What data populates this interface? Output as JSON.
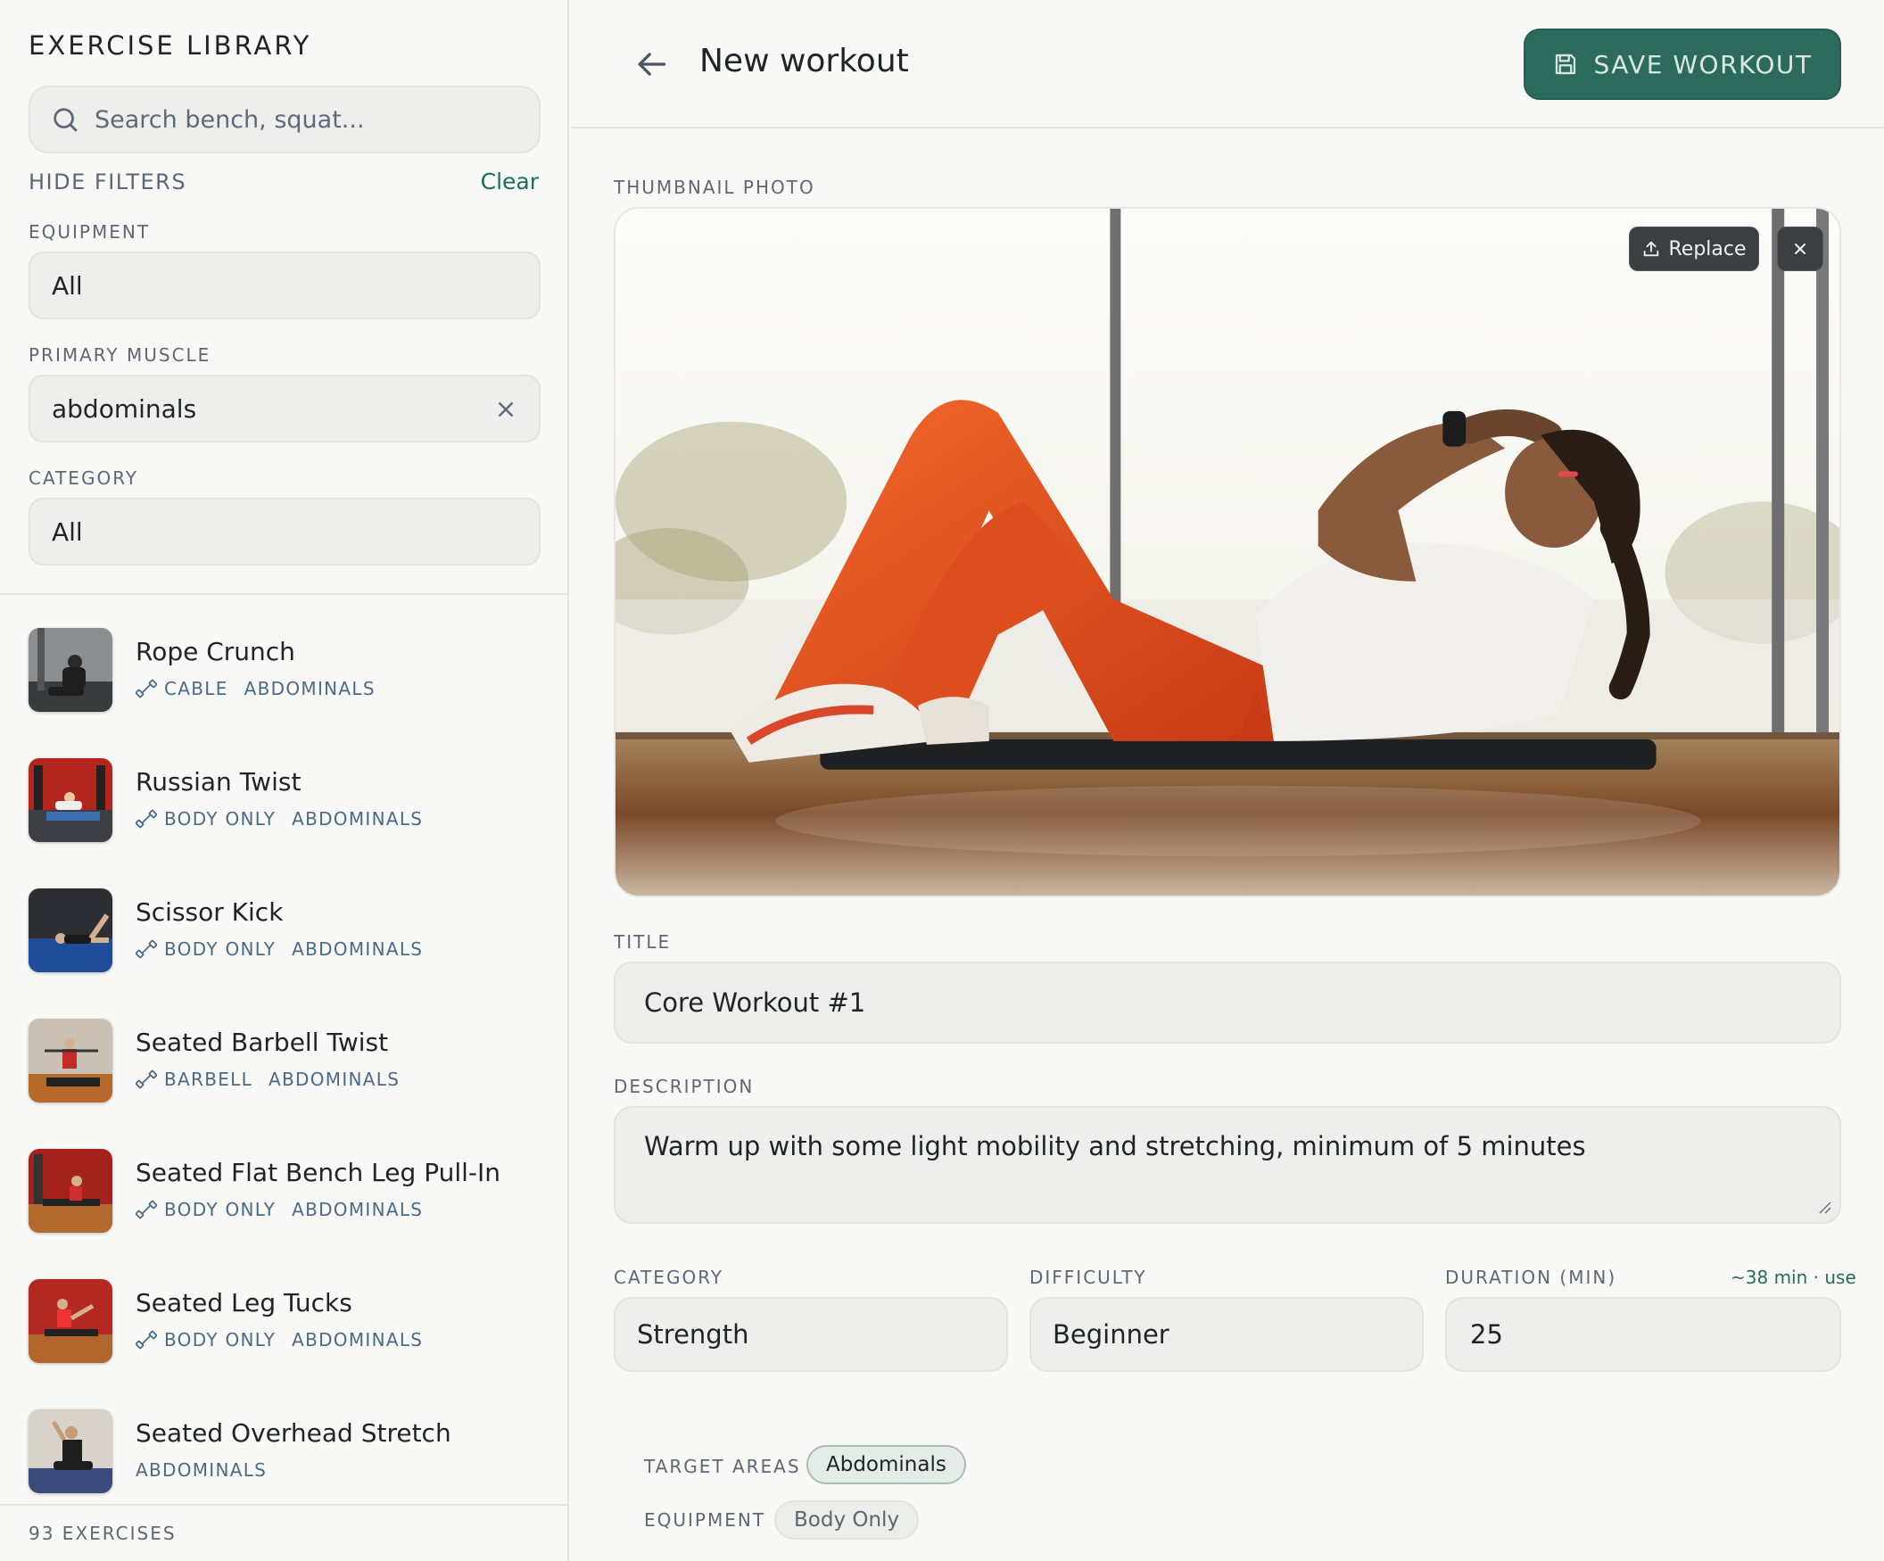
{
  "sidebar": {
    "title": "EXERCISE LIBRARY",
    "search": {
      "placeholder": "Search bench, squat..."
    },
    "filters": {
      "toggle_label": "HIDE FILTERS",
      "clear_label": "Clear",
      "equipment": {
        "label": "EQUIPMENT",
        "value": "All"
      },
      "primary_muscle": {
        "label": "PRIMARY MUSCLE",
        "value": "abdominals"
      },
      "category": {
        "label": "CATEGORY",
        "value": "All"
      }
    },
    "exercises": [
      {
        "name": "Rope Crunch",
        "equipment": "CABLE",
        "muscle": "ABDOMINALS"
      },
      {
        "name": "Russian Twist",
        "equipment": "BODY ONLY",
        "muscle": "ABDOMINALS"
      },
      {
        "name": "Scissor Kick",
        "equipment": "BODY ONLY",
        "muscle": "ABDOMINALS"
      },
      {
        "name": "Seated Barbell Twist",
        "equipment": "BARBELL",
        "muscle": "ABDOMINALS"
      },
      {
        "name": "Seated Flat Bench Leg Pull-In",
        "equipment": "BODY ONLY",
        "muscle": "ABDOMINALS"
      },
      {
        "name": "Seated Leg Tucks",
        "equipment": "BODY ONLY",
        "muscle": "ABDOMINALS"
      },
      {
        "name": "Seated Overhead Stretch",
        "equipment": "",
        "muscle": "ABDOMINALS"
      }
    ],
    "count_label": "93 EXERCISES"
  },
  "header": {
    "title": "New workout",
    "save_label": "SAVE WORKOUT"
  },
  "form": {
    "thumbnail": {
      "label": "THUMBNAIL PHOTO",
      "replace_label": "Replace"
    },
    "title": {
      "label": "TITLE",
      "value": "Core Workout #1"
    },
    "description": {
      "label": "DESCRIPTION",
      "value": "Warm up with some light mobility and stretching, minimum of 5 minutes"
    },
    "category": {
      "label": "CATEGORY",
      "value": "Strength"
    },
    "difficulty": {
      "label": "DIFFICULTY",
      "value": "Beginner"
    },
    "duration": {
      "label": "DURATION (MIN)",
      "value": "25",
      "hint": "~38 min · use"
    },
    "target_areas": {
      "label": "TARGET AREAS",
      "chips": [
        "Abdominals"
      ]
    },
    "equipment": {
      "label": "EQUIPMENT",
      "chips": [
        "Body Only"
      ]
    }
  },
  "colors": {
    "accent": "#2c6b5c",
    "meta_text": "#4b6a86",
    "surface": "#eeefec"
  }
}
